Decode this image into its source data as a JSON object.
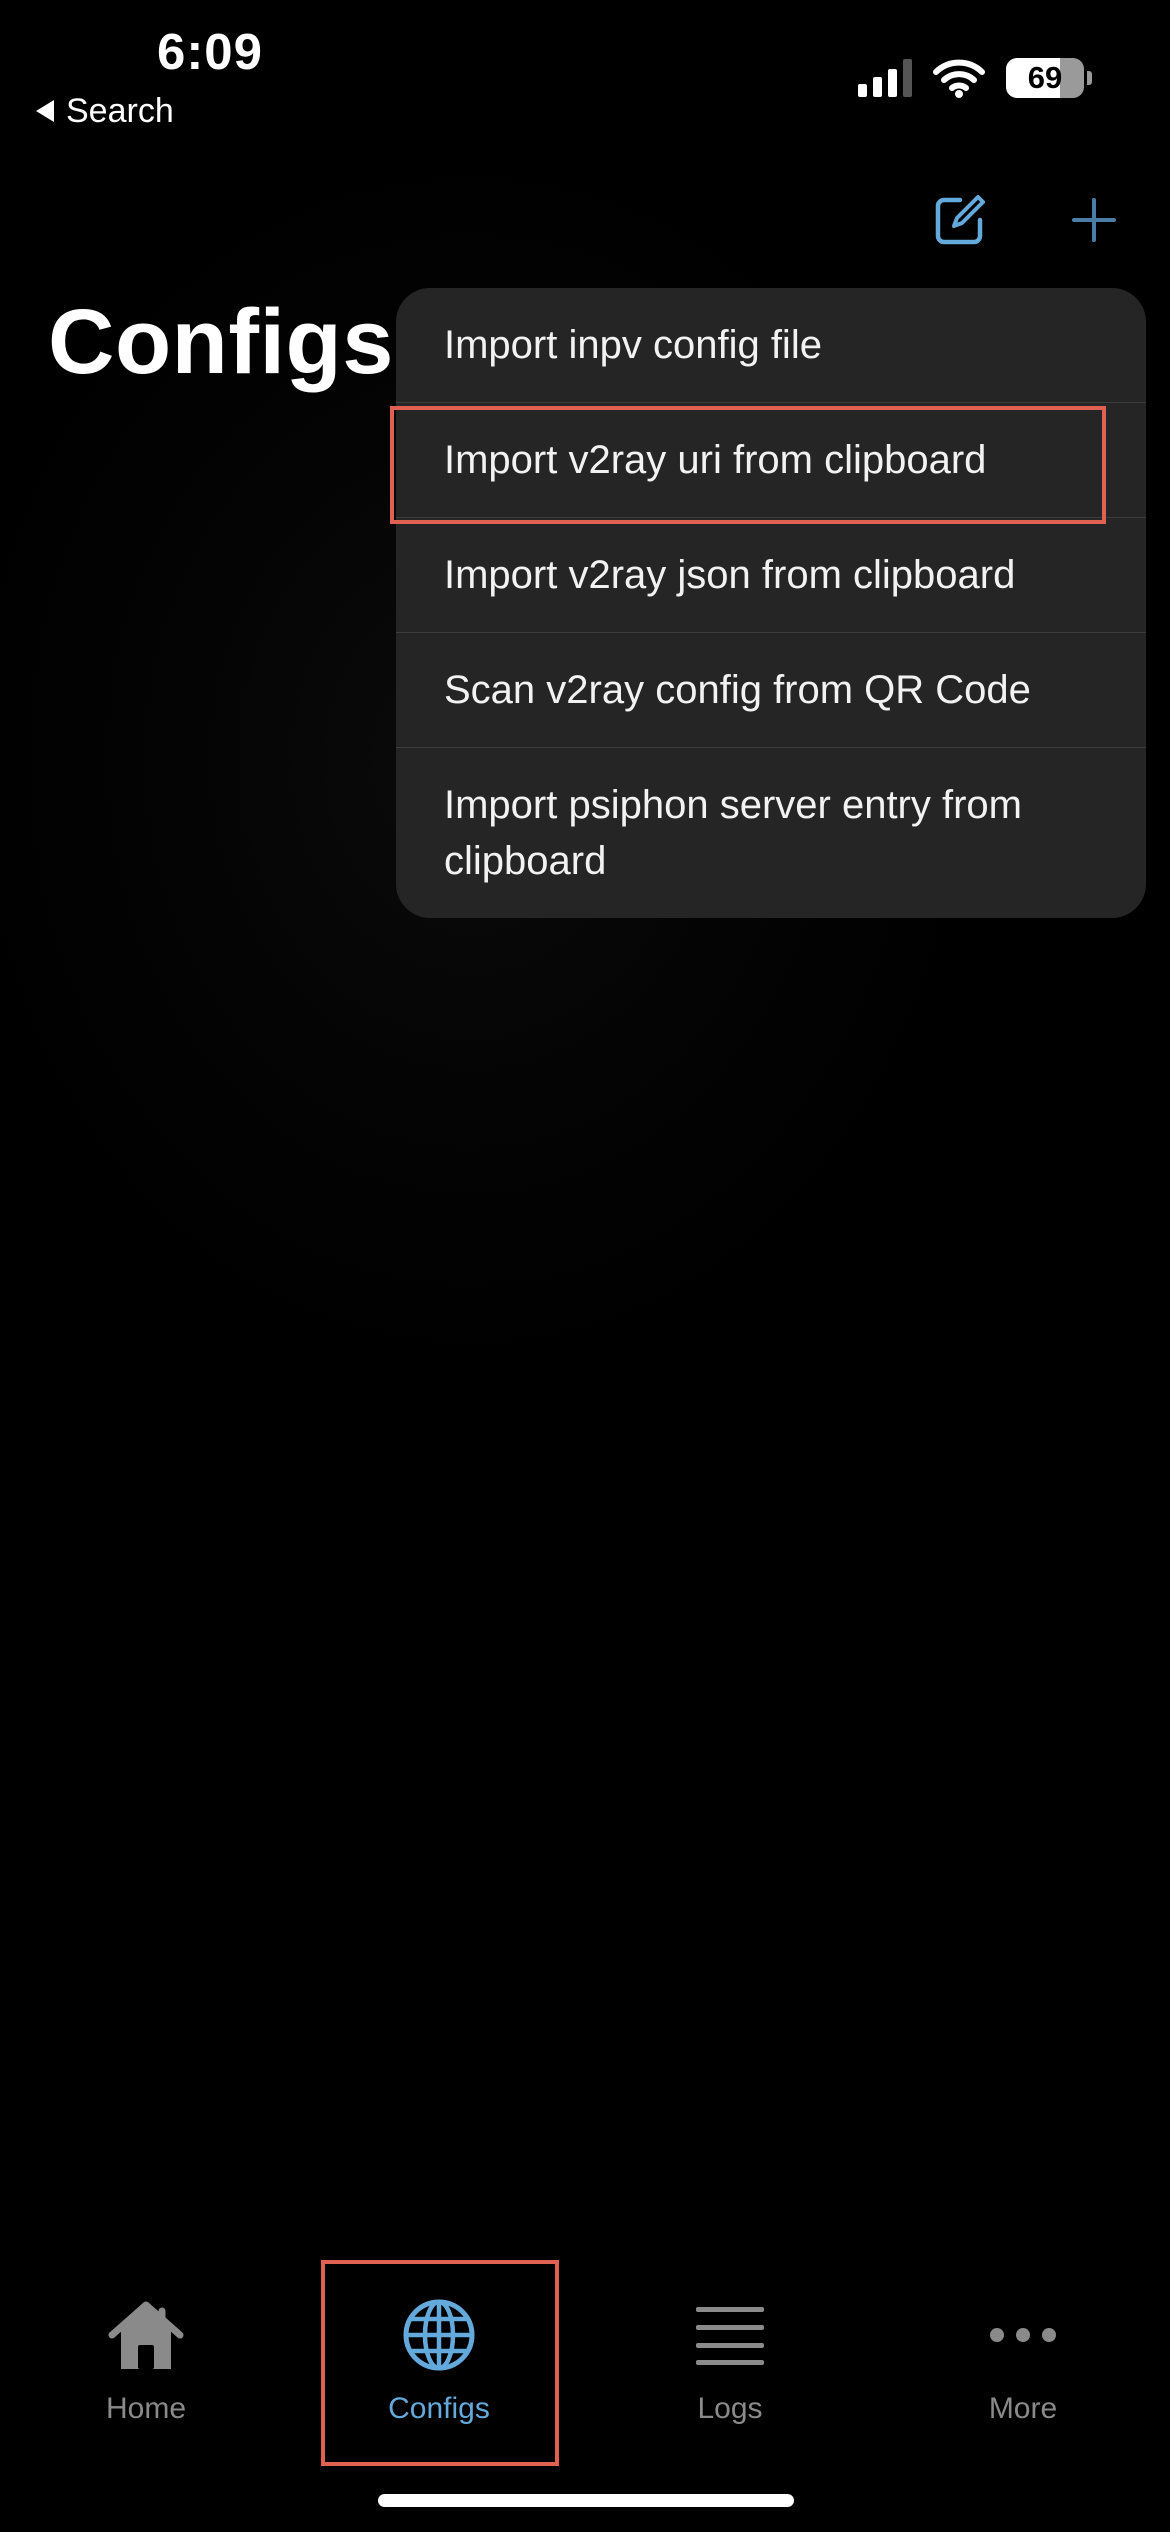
{
  "status_bar": {
    "time": "6:09",
    "back_label": "Search",
    "battery_level": 69,
    "battery_text": "69"
  },
  "nav": {
    "title": "Configs",
    "edit_icon": "square-pencil-icon",
    "add_icon": "plus-icon"
  },
  "menu": {
    "items": [
      {
        "label": "Import inpv config file"
      },
      {
        "label": "Import v2ray uri from clipboard"
      },
      {
        "label": "Import v2ray json from clipboard"
      },
      {
        "label": "Scan v2ray config from QR Code"
      },
      {
        "label": "Import psiphon server entry from clipboard"
      }
    ]
  },
  "tabs": [
    {
      "label": "Home",
      "icon": "house-icon",
      "active": false
    },
    {
      "label": "Configs",
      "icon": "globe-icon",
      "active": true
    },
    {
      "label": "Logs",
      "icon": "list-lines-icon",
      "active": false
    },
    {
      "label": "More",
      "icon": "ellipsis-icon",
      "active": false
    }
  ],
  "colors": {
    "accent": "#64a9dc",
    "inactive_tab": "#8a8a8a",
    "menu_background": "#252525",
    "highlight": "#e06052"
  }
}
